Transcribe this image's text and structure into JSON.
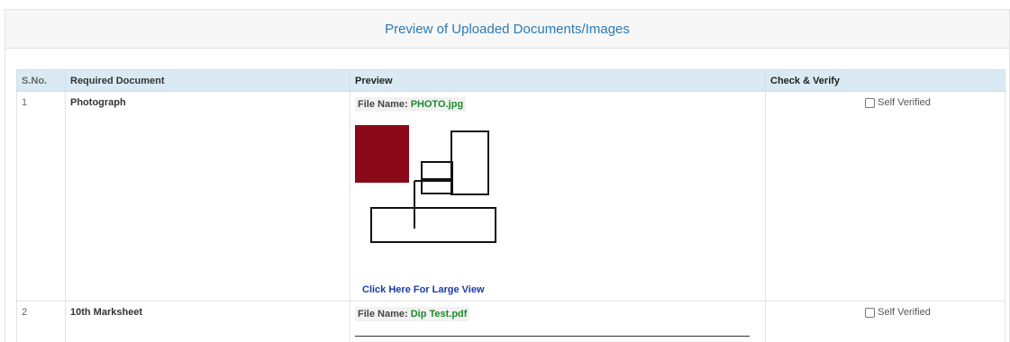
{
  "panel": {
    "title": "Preview of Uploaded Documents/Images"
  },
  "table": {
    "headers": {
      "sno": "S.No.",
      "doc": "Required Document",
      "preview": "Preview",
      "verify": "Check & Verify"
    },
    "rows": [
      {
        "sno": "1",
        "document": "Photograph",
        "file_label": "File Name:",
        "file_name": "PHOTO.jpg",
        "large_view": "Click Here For Large View",
        "verify_label": "Self Verified"
      },
      {
        "sno": "2",
        "document": "10th Marksheet",
        "file_label": "File Name:",
        "file_name": "Dip Test.pdf",
        "verify_label": "Self Verified"
      }
    ]
  },
  "colors": {
    "title": "#2a7ab8",
    "header_bg": "#d9eaf5",
    "file_name": "#1d8a2a",
    "link": "#1a3aa8",
    "photo_block": "#8b0a1a"
  }
}
